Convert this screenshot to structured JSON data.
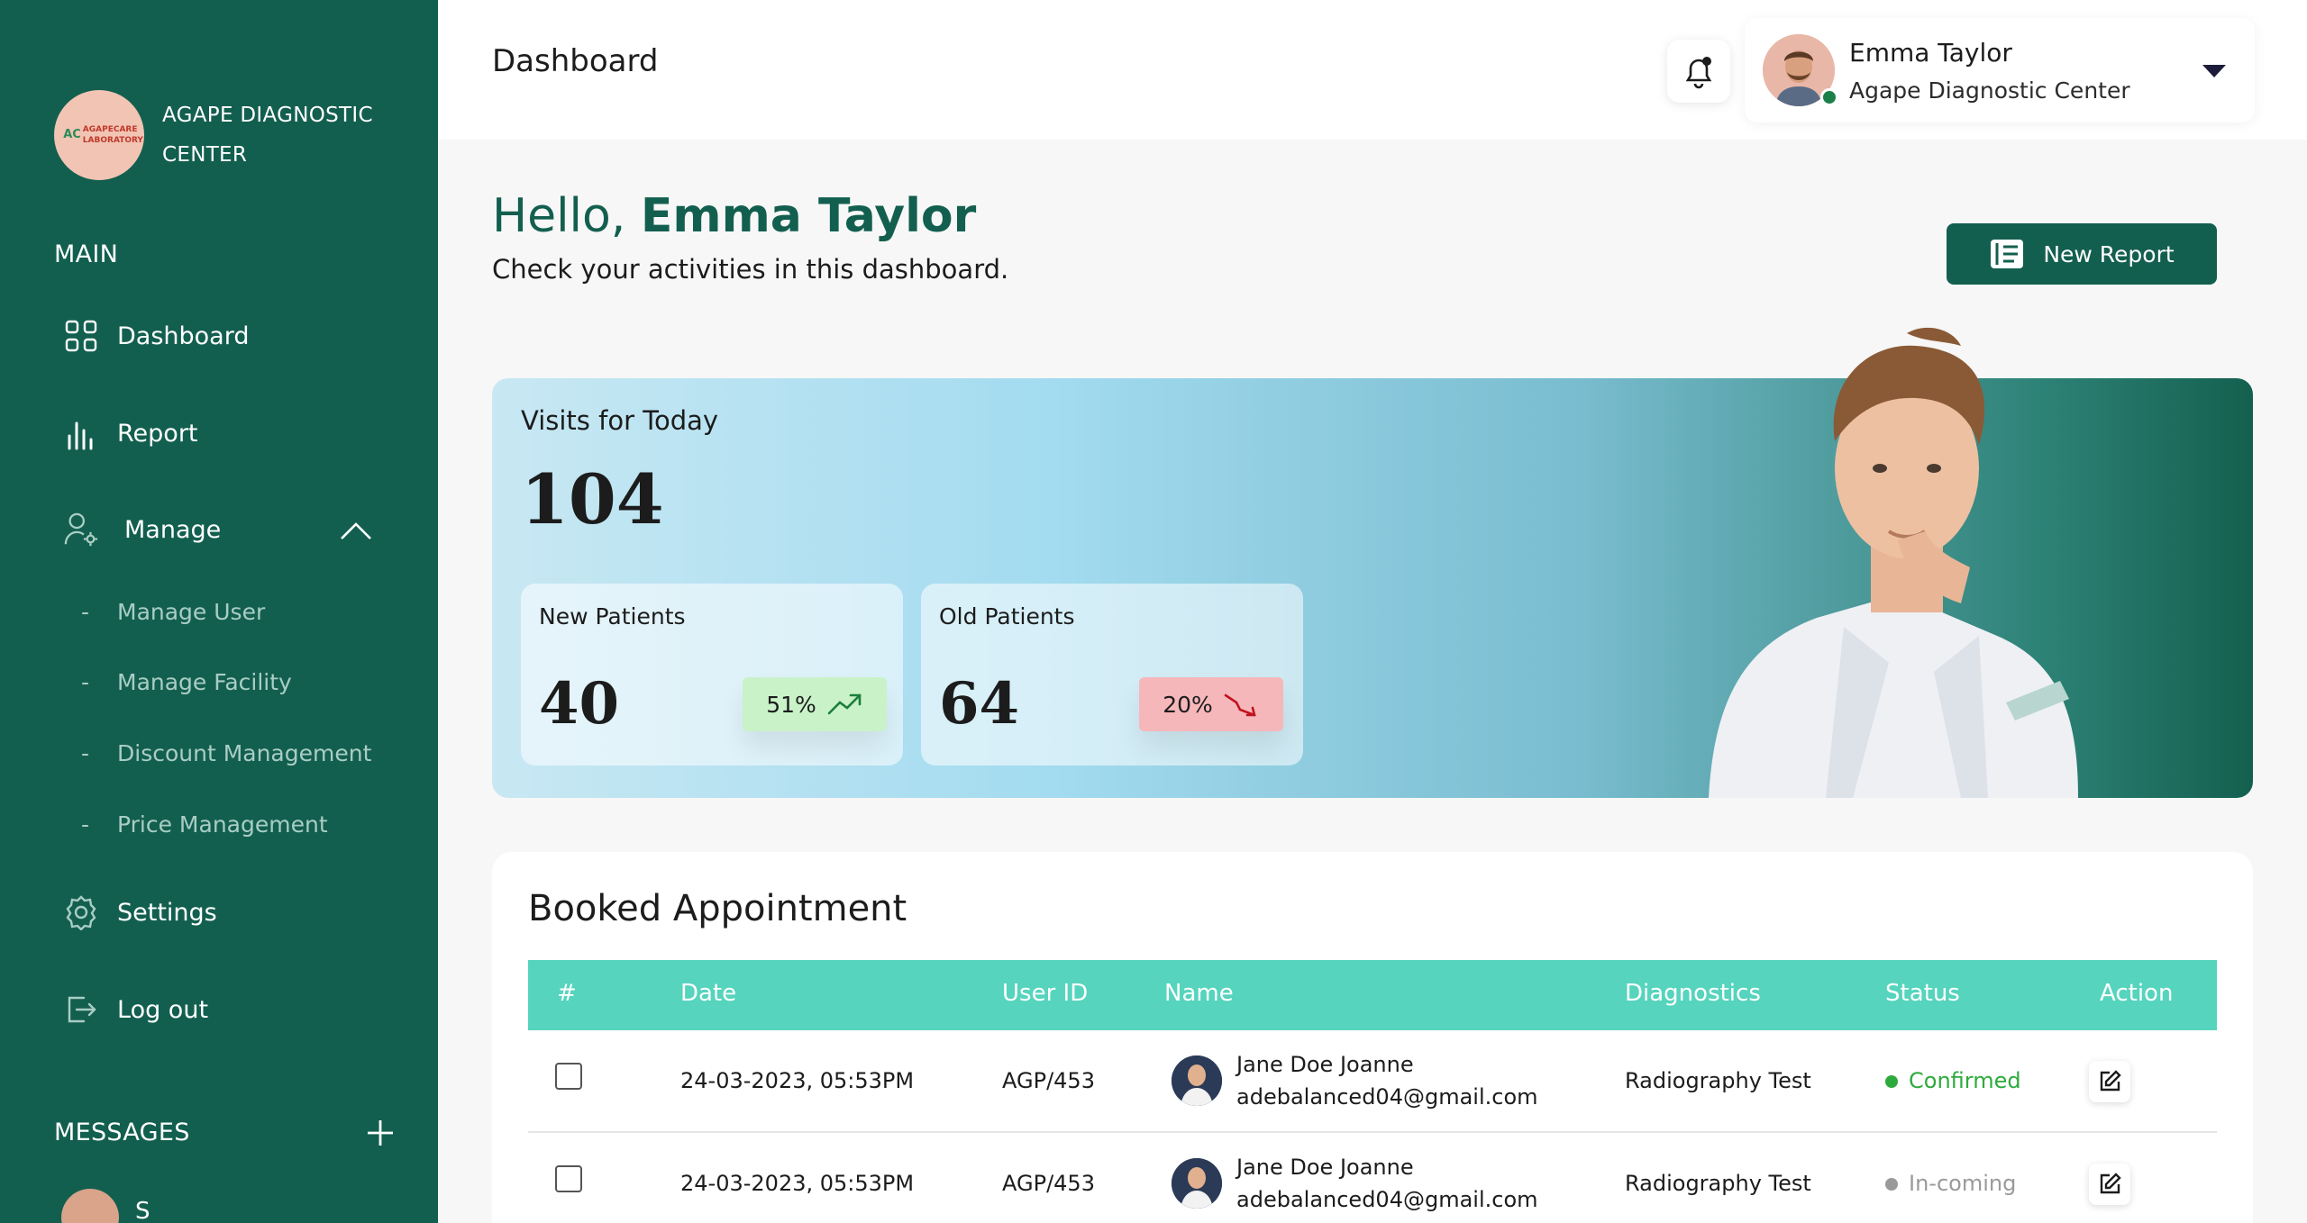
{
  "brand": {
    "logo_text": "AGAPECARE LABORATORY",
    "logo_mark": "AC",
    "name": "AGAPE DIAGNOSTIC CENTER"
  },
  "sidebar": {
    "main_label": "MAIN",
    "items": [
      {
        "label": "Dashboard",
        "icon": "grid-icon"
      },
      {
        "label": "Report",
        "icon": "bar-chart-icon"
      },
      {
        "label": "Manage",
        "icon": "user-gear-icon"
      },
      {
        "label": "Settings",
        "icon": "gear-icon"
      },
      {
        "label": "Log out",
        "icon": "logout-icon"
      }
    ],
    "sub_items": [
      {
        "dash": "-",
        "label": "Manage User"
      },
      {
        "dash": "-",
        "label": "Manage Facility"
      },
      {
        "dash": "-",
        "label": "Discount Management"
      },
      {
        "dash": "-",
        "label": "Price Management"
      }
    ],
    "messages_label": "MESSAGES",
    "message_preview_name": "S"
  },
  "header": {
    "title": "Dashboard",
    "user_name": "Emma Taylor",
    "user_org": "Agape Diagnostic Center"
  },
  "greeting": {
    "hello": "Hello, ",
    "name": "Emma Taylor",
    "subtitle": "Check your activities in this dashboard."
  },
  "actions": {
    "new_report": "New Report"
  },
  "visits": {
    "label": "Visits for Today",
    "value": "104",
    "new_patients": {
      "label": "New Patients",
      "value": "40",
      "change": "51%",
      "trend": "up"
    },
    "old_patients": {
      "label": "Old Patients",
      "value": "64",
      "change": "20%",
      "trend": "down"
    }
  },
  "appointments": {
    "title": "Booked Appointment",
    "columns": [
      "#",
      "Date",
      "User ID",
      "Name",
      "Diagnostics",
      "Status",
      "Action"
    ],
    "rows": [
      {
        "date": "24-03-2023, 05:53PM",
        "user_id": "AGP/453",
        "name": "Jane Doe Joanne",
        "email": "adebalanced04@gmail.com",
        "diagnostics": "Radiography Test",
        "status": "Confirmed",
        "status_color": "#2eaa3c"
      },
      {
        "date": "24-03-2023, 05:53PM",
        "user_id": "AGP/453",
        "name": "Jane Doe Joanne",
        "email": "adebalanced04@gmail.com",
        "diagnostics": "Radiography Test",
        "status": "In-coming",
        "status_color": "#9a9a9a"
      }
    ]
  },
  "colors": {
    "primary": "#135f4f",
    "table_header": "#56d4bd",
    "confirmed": "#2eaa3c",
    "incoming": "#9a9a9a"
  }
}
